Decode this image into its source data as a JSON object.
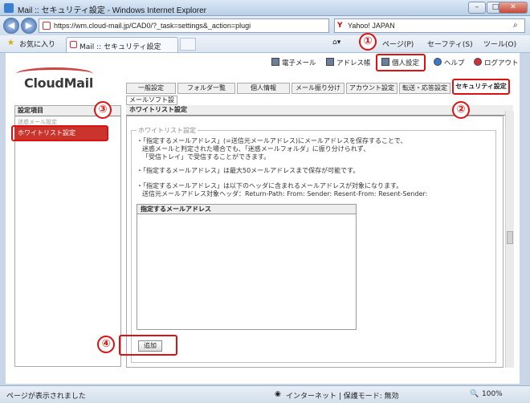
{
  "browser": {
    "title": "Mail :: セキュリティ設定 - Windows Internet Explorer",
    "url": "https://wm.cloud-mail.jp/CAD0/?_task=settings&_action=plugi",
    "search_label": "Yahoo! JAPAN",
    "favorites_label": "お気に入り",
    "tab_title": "Mail :: セキュリティ設定",
    "cmd_page": "ページ(P)",
    "cmd_safety": "セーフティ(S)",
    "cmd_tools": "ツール(O)",
    "status_text": "ページが表示されました",
    "zone_text": "インターネット | 保護モード: 無効",
    "zoom": "100%"
  },
  "app": {
    "logo": "CloudMail",
    "topnav": {
      "mail": "電子メール",
      "address": "アドレス帳",
      "personal": "個人設定",
      "help": "ヘルプ",
      "logout": "ログアウト"
    },
    "tabs": [
      "一般設定",
      "フォルダ一覧",
      "個人情報",
      "メール振り分け",
      "アカウント設定",
      "転送・応答設定"
    ],
    "active_tab": "セキュリティ設定",
    "subtab": "メールソフト設定",
    "left_header": "設定項目",
    "left_partial": "迷惑メール設定",
    "left_selected": "ホワイトリスト設定",
    "section_title": "ホワイトリスト設定",
    "legend": "ホワイトリスト設定",
    "para1": [
      "・「指定するメールアドレス」(=送信元メールアドレス)にメールアドレスを保存することで、",
      "迷惑メールと判定された場合でも、「迷惑メールフォルダ」に振り分けられず、",
      "「受信トレイ」で受信することができます。"
    ],
    "para2": "・「指定するメールアドレス」は最大50メールアドレスまで保存が可能です。",
    "para3": [
      "・「指定するメールアドレス」は以下のヘッダに含まれるメールアドレスが対象になります。",
      "送信元メールアドレス対象ヘッダ：Return-Path: From: Sender: Resent-From: Resent-Sender:"
    ],
    "table_header": "指定するメールアドレス",
    "add_button": "追加"
  },
  "annotations": [
    "①",
    "②",
    "③",
    "④"
  ]
}
